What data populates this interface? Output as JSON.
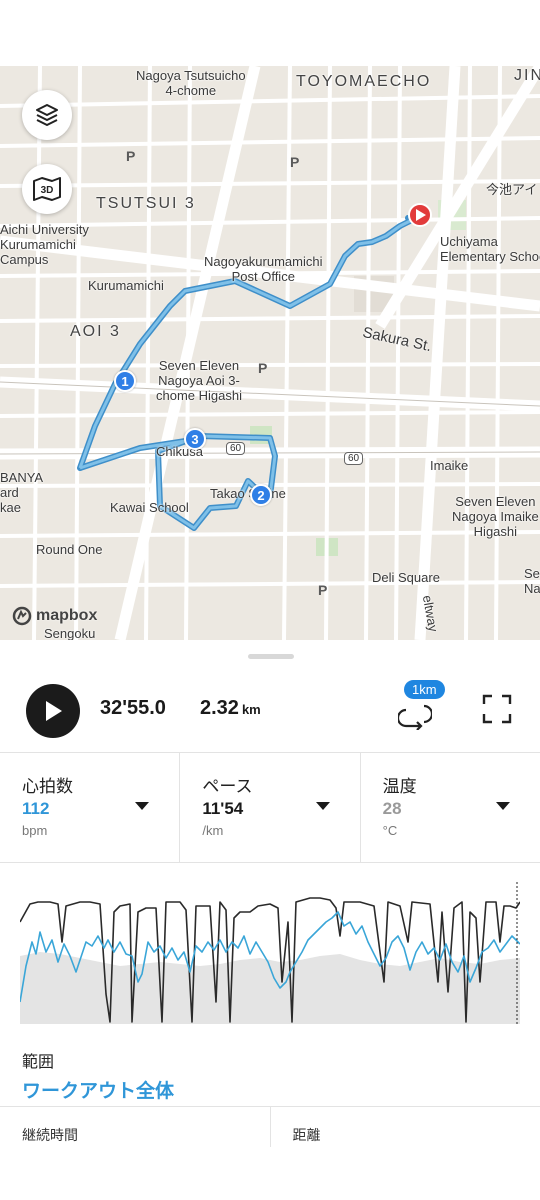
{
  "map": {
    "labels": {
      "nagoya_tsutsuicho": "Nagoya Tsutsuicho\n4-chome",
      "toyomaecho": "TOYOMAECHO",
      "jin": "JIN",
      "tsutsui3": "TSUTSUI 3",
      "aichi_university": "Aichi University\nKurumamichi\nCampus",
      "kurumamichi": "Kurumamichi",
      "aoi3": "AOI 3",
      "nagoyakurumamichi_po": "Nagoyakurumamichi\nPost Office",
      "uchiyama_school": "Uchiyama\nElementary School",
      "imaike_kanji": "今池アイ",
      "sakura_st": "Sakura St.",
      "seven_eleven_aoi": "Seven Eleven\nNagoya Aoi 3-\nchome Higashi",
      "chikusa": "Chikusa",
      "takao_shrine": "Takao Shrine",
      "imaike": "Imaike",
      "banya": "BANYA\nard\nkae",
      "kawai_school": "Kawai School",
      "seven_eleven_imaike": "Seven Eleven\nNagoya Imaike\nHigashi",
      "round_one": "Round One",
      "deli_square": "Deli Square",
      "beltway": "eltway",
      "sengoku": "Sengoku",
      "se_na": "Se\nNa",
      "route60_a": "60",
      "route60_b": "60",
      "mapbox": "mapbox"
    },
    "lap_markers": [
      "1",
      "2",
      "3"
    ],
    "route_color": "#5aa9d6",
    "end_marker_color": "#e23b3b",
    "buttons": {
      "layers": "layers-icon",
      "three_d": "3D"
    }
  },
  "playback": {
    "elapsed": "32'55.0",
    "distance": "2.32",
    "distance_unit": "km",
    "lap_interval": "1km"
  },
  "metrics": [
    {
      "title": "心拍数",
      "value": "112",
      "unit": "bpm",
      "value_color": "#2f96d8"
    },
    {
      "title": "ペース",
      "value": "11'54",
      "unit": "/km",
      "value_color": "#1a1a1a"
    },
    {
      "title": "温度",
      "value": "28",
      "unit": "°C",
      "value_color": "#9a9a9a"
    }
  ],
  "range": {
    "label": "範囲",
    "value": "ワークアウト全体"
  },
  "bottom_stats": [
    {
      "label": "継続時間"
    },
    {
      "label": "距離"
    }
  ]
}
